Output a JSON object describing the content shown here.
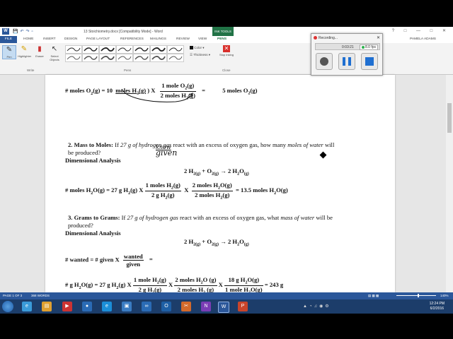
{
  "window": {
    "title": "13 Stoichiometry.docx [Compatibility Mode] - Word",
    "context_tab": "INK TOOLS",
    "user": "PAMELA ADAMS"
  },
  "tabs": [
    "FILE",
    "HOME",
    "INSERT",
    "DESIGN",
    "PAGE LAYOUT",
    "REFERENCES",
    "MAILINGS",
    "REVIEW",
    "VIEW",
    "PENS"
  ],
  "ribbon": {
    "write_buttons": [
      "Pen",
      "Highlighter",
      "Eraser",
      "Select Objects"
    ],
    "write_group": "Write",
    "pens_group": "Pens",
    "color_label": "Color",
    "thickness_label": "Thickness",
    "stop_label": "Stop Inking",
    "close_group": "Close"
  },
  "recorder": {
    "title": "Recording...",
    "timer": "0:03:21",
    "fps": "8.0 fps"
  },
  "document": {
    "line1": {
      "lhs": "# moles O",
      "eq1": "(g) = 10",
      "moles_h2": "moles H",
      "x": ") X",
      "num": "1 mole O",
      "num2": "(g)",
      "den": "2 moles H",
      "den2": "(g)",
      "eq": "=",
      "result": "5 moles O",
      "result2": "(g)"
    },
    "q2": {
      "number": "2.  Mass to Moles:",
      "text1": " If ",
      "given": "27 g of hydrogen gas",
      "text2": " react with an excess of oxygen gas, how many ",
      "wanted": "moles of water",
      "text3": " will",
      "text4": "be produced?",
      "heading": "Dimensional Analysis",
      "reaction": "2 H",
      "reaction_mid": "+ O",
      "reaction_end": "2 H",
      "calc_lhs": "# moles H",
      "calc_given": "= 27 g H",
      "f1_num": "1 moles H",
      "f1_den": "2 g H",
      "f2_num": "2 moles H",
      "f2_den": "2 moles H",
      "result": "= 13.5 moles H",
      "handwriting1": "know",
      "handwriting2": "given"
    },
    "q3": {
      "number": "3.  Grams to Grams:",
      "text1": " If ",
      "given": "27 g of hydrogen gas",
      "text2": " react with an excess of oxygen gas, what ",
      "wanted": "mass of water",
      "text3": " will be",
      "text4": "produced?",
      "heading": "Dimensional Analysis",
      "wanted_line_lhs": "# wanted = # given X",
      "wanted_num": "wanted",
      "wanted_den": "given",
      "eq": "=",
      "calc_lhs": "# g H",
      "calc_given": "= 27 g H",
      "f1_num": "1 mole H",
      "f1_den": "2 g H",
      "f2_num": "2 moles H",
      "f2_den": "2 moles H",
      "f3_num": "18 g H",
      "f3_den": "1 mole H",
      "result": "= 243 g"
    }
  },
  "status": {
    "page": "PAGE 1 OF 3",
    "words": "368 WORDS",
    "zoom": "140%"
  },
  "clock": {
    "time": "12:24 PM",
    "date": "6/2/2016"
  },
  "colors": {
    "word_blue": "#2b579a",
    "ink_green": "#217346",
    "taskbar": "#1c3d6a"
  }
}
